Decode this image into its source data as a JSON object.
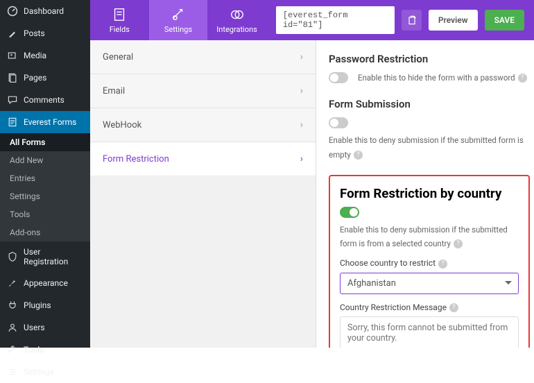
{
  "wp_menu": {
    "dashboard": "Dashboard",
    "posts": "Posts",
    "media": "Media",
    "pages": "Pages",
    "comments": "Comments",
    "everest_forms": "Everest Forms",
    "user_registration": "User Registration",
    "appearance": "Appearance",
    "plugins": "Plugins",
    "users": "Users",
    "tools": "Tools",
    "settings": "Settings"
  },
  "wp_submenu": {
    "all_forms": "All Forms",
    "add_new": "Add New",
    "entries": "Entries",
    "settings": "Settings",
    "tools": "Tools",
    "addons": "Add-ons"
  },
  "toolbar": {
    "fields": "Fields",
    "settings": "Settings",
    "integrations": "Integrations",
    "shortcode": "[everest_form id=\"81\"]",
    "preview": "Preview",
    "save": "SAVE"
  },
  "settings_tabs": {
    "general": "General",
    "email": "Email",
    "webhook": "WebHook",
    "form_restriction": "Form Restriction"
  },
  "panel": {
    "password_title": "Password Restriction",
    "password_desc": "Enable this to hide the form with a password",
    "submission_title": "Form Submission",
    "submission_desc": "Enable this to deny submission if the submitted form is empty",
    "country_title": "Form Restriction by country",
    "country_toggle_desc": "Enable this to deny submission if the submitted form is from a selected country",
    "choose_country_label": "Choose country to restrict",
    "country_value": "Afghanistan",
    "restriction_msg_label": "Country Restriction Message",
    "restriction_msg_placeholder": "Sorry, this form cannot be submitted from your country."
  }
}
